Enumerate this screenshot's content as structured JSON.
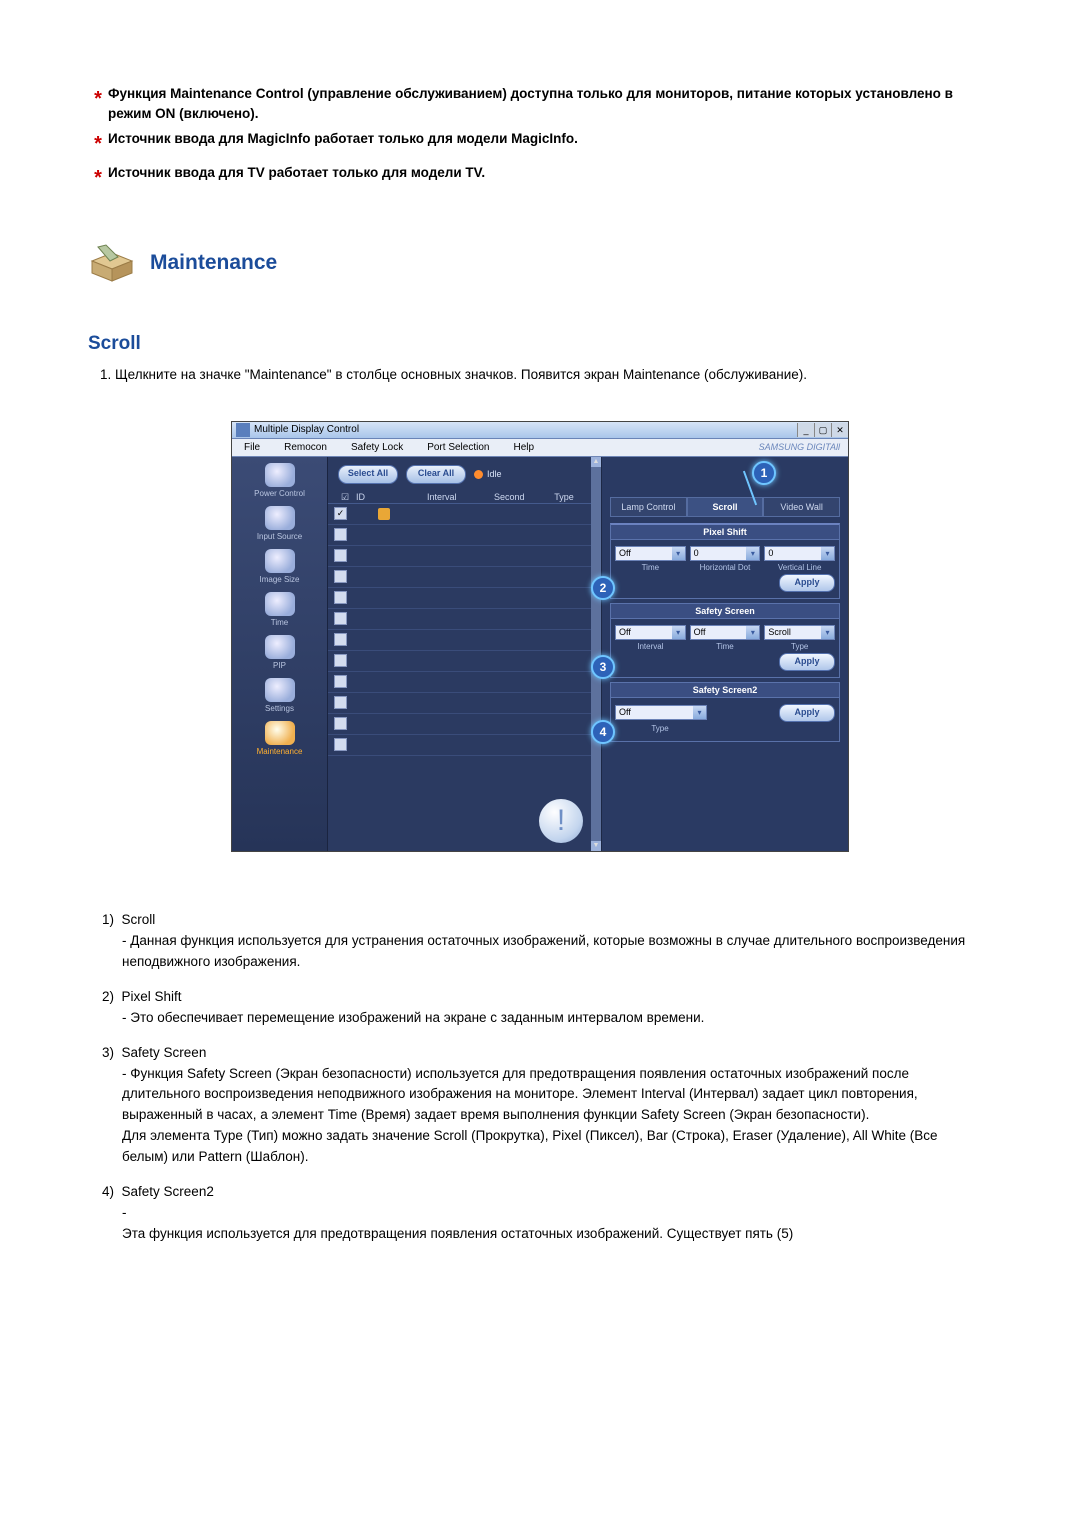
{
  "notes": [
    "Функция Maintenance Control (управление обслуживанием) доступна только для мониторов, питание которых установлено в режим ON (включено).",
    "Источник ввода для MagicInfo работает только для модели MagicInfo.",
    "Источник ввода для TV работает только для модели TV."
  ],
  "section": {
    "title": "Maintenance"
  },
  "subsection": {
    "title": "Scroll"
  },
  "step1": "1.  Щелкните на значке \"Maintenance\" в столбце основных значков. Появится экран Maintenance (обслуживание).",
  "app": {
    "title": "Multiple Display Control",
    "menu": [
      "File",
      "Remocon",
      "Safety Lock",
      "Port Selection",
      "Help"
    ],
    "brand": "SAMSUNG DIGITAll",
    "sidebar": [
      "Power Control",
      "Input Source",
      "Image Size",
      "Time",
      "PIP",
      "Settings",
      "Maintenance"
    ],
    "toolbar": {
      "selectAll": "Select All",
      "clearAll": "Clear All",
      "idle": "Idle"
    },
    "gridHead": {
      "id": "ID",
      "interval": "Interval",
      "second": "Second",
      "type": "Type"
    },
    "tabs": [
      "Lamp Control",
      "Scroll",
      "Video Wall"
    ],
    "pixelShift": {
      "head": "Pixel Shift",
      "val1": "Off",
      "val2": "0",
      "val3": "0",
      "l1": "Time",
      "l2": "Horizontal Dot",
      "l3": "Vertical Line",
      "apply": "Apply"
    },
    "safetyScreen": {
      "head": "Safety Screen",
      "v1": "Off",
      "v2": "Off",
      "v3": "Scroll",
      "l1": "Interval",
      "l2": "Time",
      "l3": "Type",
      "apply": "Apply"
    },
    "safetyScreen2": {
      "head": "Safety Screen2",
      "v1": "Off",
      "l1": "Type",
      "apply": "Apply"
    },
    "callouts": {
      "1": "1",
      "2": "2",
      "3": "3",
      "4": "4"
    }
  },
  "defs": [
    {
      "num": "1)",
      "title": "Scroll",
      "body": "- Данная функция используется для устранения остаточных изображений, которые возможны в случае длительного воспроизведения неподвижного изображения."
    },
    {
      "num": "2)",
      "title": "Pixel Shift",
      "body": "- Это обеспечивает перемещение изображений на экране с заданным интервалом времени."
    },
    {
      "num": "3)",
      "title": "Safety Screen",
      "body": "- Функция Safety Screen (Экран безопасности) используется для предотвращения появления остаточных изображений после длительного воспроизведения неподвижного изображения на мониторе. Элемент Interval (Интервал) задает цикл повторения, выраженный в часах, а элемент Time (Время) задает время выполнения функции Safety Screen (Экран безопасности).\nДля элемента Type (Тип) можно задать значение Scroll (Прокрутка), Pixel (Пиксел), Bar (Строка), Eraser (Удаление), All White (Все белым) или Pattern (Шаблон)."
    },
    {
      "num": "4)",
      "title": "Safety Screen2",
      "body": "-\nЭта функция используется для предотвращения появления остаточных изображений. Существует пять (5)"
    }
  ]
}
